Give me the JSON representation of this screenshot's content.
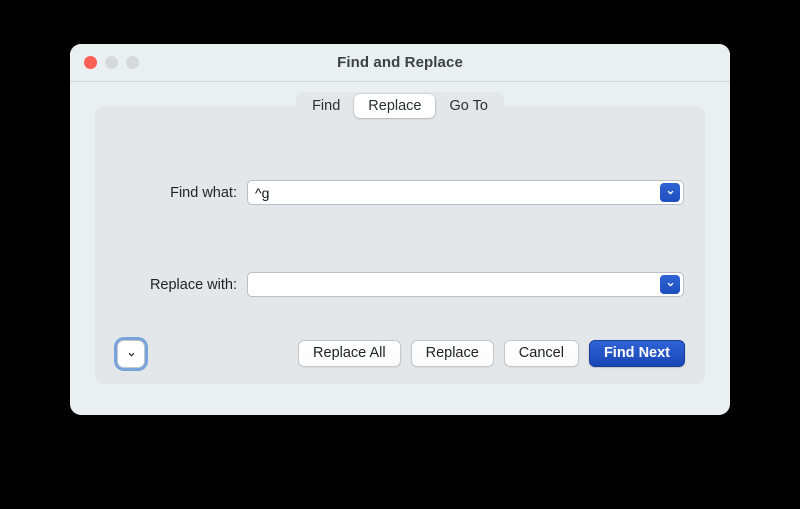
{
  "window": {
    "title": "Find and Replace",
    "traffic_lights": [
      {
        "name": "close",
        "color": "#ff5f57"
      },
      {
        "name": "minimize",
        "color": "#d5d9dc"
      },
      {
        "name": "zoom",
        "color": "#d5d9dc"
      }
    ]
  },
  "tabs": [
    {
      "label": "Find",
      "selected": false
    },
    {
      "label": "Replace",
      "selected": true
    },
    {
      "label": "Go To",
      "selected": false
    }
  ],
  "fields": {
    "find": {
      "label": "Find what:",
      "value": "^g",
      "placeholder": "",
      "dropdown_icon": "chevron-down-icon"
    },
    "replace": {
      "label": "Replace with:",
      "value": "",
      "placeholder": "",
      "dropdown_icon": "chevron-down-icon"
    }
  },
  "expand": {
    "icon": "chevron-down-icon"
  },
  "buttons": {
    "replace_all": "Replace All",
    "replace": "Replace",
    "cancel": "Cancel",
    "find_next": "Find Next"
  },
  "colors": {
    "accent": "#2f63d4",
    "accent_dark": "#1a46b6",
    "window_bg": "#eaeff1",
    "panel_bg": "#e3e7ea",
    "close_red": "#ff5f57"
  }
}
